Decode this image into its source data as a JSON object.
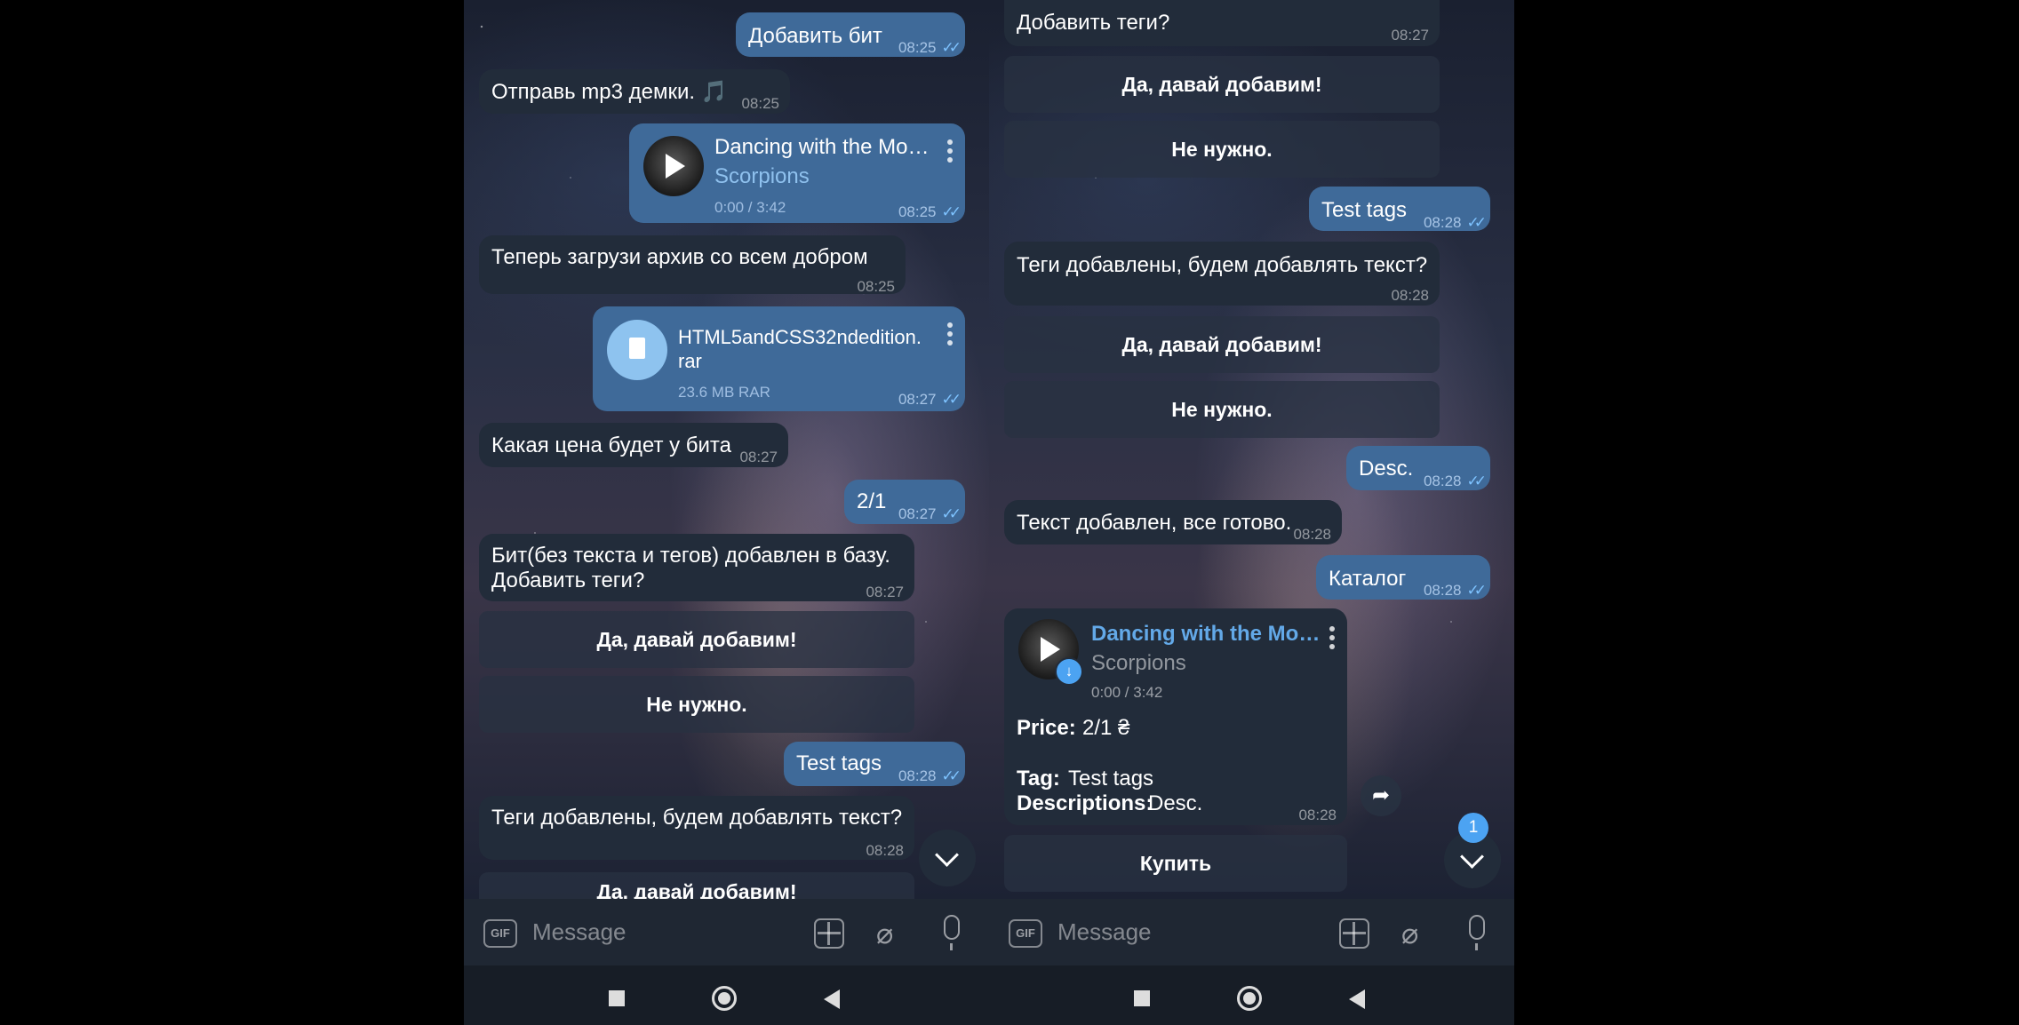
{
  "time": "08:25",
  "left": {
    "messages": [
      {
        "text": "Добавить бит",
        "time": "08:25"
      },
      {
        "text": "Отправь mp3 демки. 🎵",
        "time": "08:25"
      },
      {
        "audio_title": "Dancing with the Mo…",
        "audio_artist": "Scorpions",
        "audio_duration": "0:00 / 3:42",
        "time": "08:25"
      },
      {
        "text": "Теперь загрузи архив со всем добром",
        "time": "08:25"
      },
      {
        "file_name_1": "HTML5andCSS32ndedition.",
        "file_name_2": "rar",
        "file_size": "23.6 MB RAR",
        "time": "08:27"
      },
      {
        "text": "Какая цена будет у бита",
        "time": "08:27"
      },
      {
        "text": "2/1",
        "time": "08:27"
      },
      {
        "text_1": "Бит(без текста и тегов) добавлен в базу.",
        "text_2": "Добавить теги?",
        "time": "08:27"
      },
      {
        "text": "Test tags",
        "time": "08:28"
      },
      {
        "text": "Теги добавлены, будем добавлять текст?",
        "time": "08:28"
      }
    ],
    "buttons": [
      "Да, давай добавим!",
      "Не нужно.",
      "Да, давай добавим!"
    ]
  },
  "right": {
    "messages": [
      {
        "text": "Добавить теги?",
        "time": "08:27"
      },
      {
        "text": "Test tags",
        "time": "08:28"
      },
      {
        "text": "Теги добавлены, будем добавлять текст?",
        "time": "08:28"
      },
      {
        "text": "Desc.",
        "time": "08:28"
      },
      {
        "text": "Текст добавлен, все готово.",
        "time": "08:28"
      },
      {
        "text": "Каталог",
        "time": "08:28"
      }
    ],
    "buttons": [
      "Да, давай добавим!",
      "Не нужно.",
      "Да, давай добавим!",
      "Не нужно.",
      "Купить"
    ],
    "card": {
      "audio_title": "Dancing with the Mo…",
      "audio_artist": "Scorpions",
      "audio_duration": "0:00 / 3:42",
      "price_label": "Price:",
      "price_value": "2/1 ₴",
      "tag_label": "Tag:",
      "tag_value": "Test tags",
      "desc_label": "Descriptions:",
      "desc_value": "Desc.",
      "time": "08:28"
    },
    "unread_badge": "1"
  },
  "composer": {
    "gif": "GIF",
    "placeholder": "Message"
  },
  "icons": {
    "attach": "attach-icon",
    "mic": "microphone-icon",
    "stickers": "sticker-grid-icon",
    "gif": "gif-icon"
  },
  "colors": {
    "outgoing": "#3f6a99",
    "incoming": "#222c3a",
    "accent": "#4ca3f2",
    "ticks": "#7ec3ff"
  }
}
